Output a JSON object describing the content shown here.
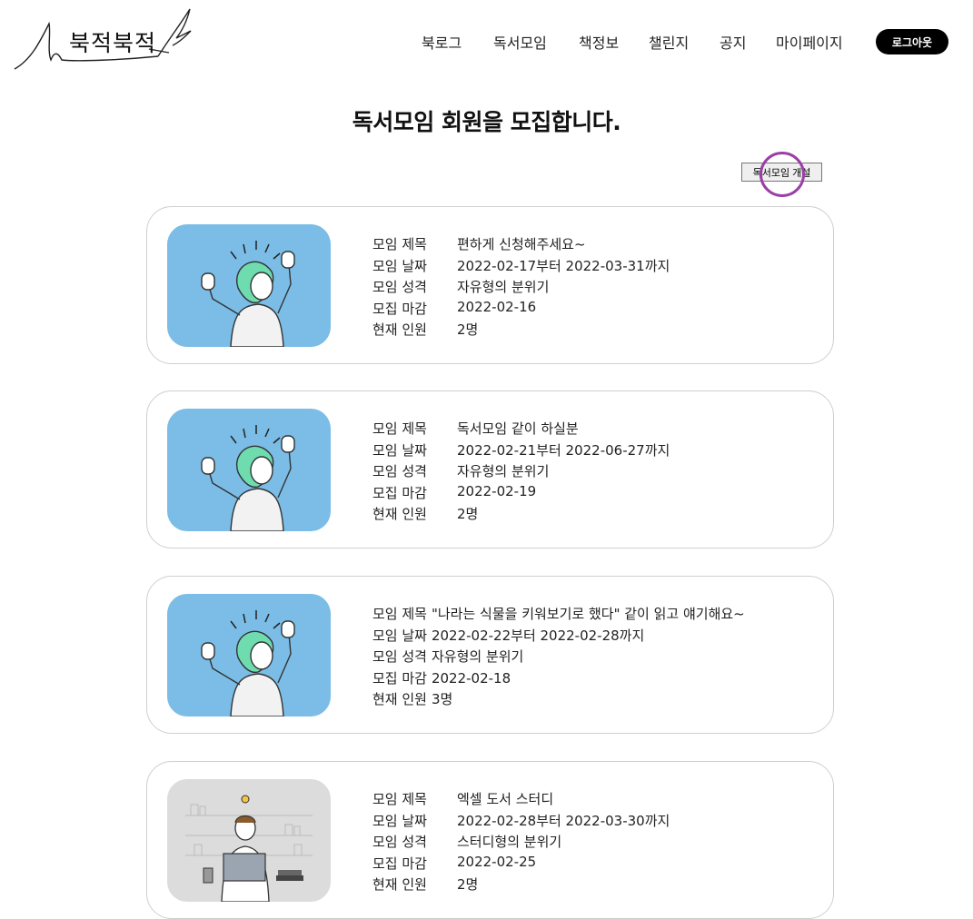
{
  "brand": {
    "logo_text": "북적북적"
  },
  "nav": {
    "items": [
      "북로그",
      "독서모임",
      "책정보",
      "챌린지",
      "공지",
      "마이페이지"
    ],
    "logout_label": "로그아웃"
  },
  "page": {
    "title": "독서모임 회원을 모집합니다.",
    "create_button_label": "독서모임 개설"
  },
  "labels": {
    "title": "모임 제목",
    "date": "모임 날짜",
    "style": "모임 성격",
    "deadline": "모집 마감",
    "members": "현재 인원"
  },
  "meetings": [
    {
      "image": "thumbs-up-person-illustration",
      "title": "편하게 신청해주세요~",
      "date": "2022-02-17부터 2022-03-31까지",
      "style": "자유형의 분위기",
      "deadline": "2022-02-16",
      "members": "2명"
    },
    {
      "image": "thumbs-up-person-illustration",
      "title": "독서모임 같이 하실분",
      "date": "2022-02-21부터 2022-06-27까지",
      "style": "자유형의 분위기",
      "deadline": "2022-02-19",
      "members": "2명"
    },
    {
      "image": "thumbs-up-person-illustration",
      "title": "\"나라는 식물을 키워보기로 했다\" 같이 읽고 얘기해요~",
      "date": "2022-02-22부터 2022-02-28까지",
      "style": "자유형의 분위기",
      "deadline": "2022-02-18",
      "members": "3명"
    },
    {
      "image": "study-person-laptop-illustration",
      "title": "엑셀 도서 스터디",
      "date": "2022-02-28부터 2022-03-30까지",
      "style": "스터디형의 분위기",
      "deadline": "2022-02-25",
      "members": "2명"
    }
  ],
  "colors": {
    "accent": "#000000",
    "image_bg_blue": "#7bbde6",
    "image_bg_gray": "#dcdcdc",
    "cursor_ring": "#9b3fa6"
  }
}
